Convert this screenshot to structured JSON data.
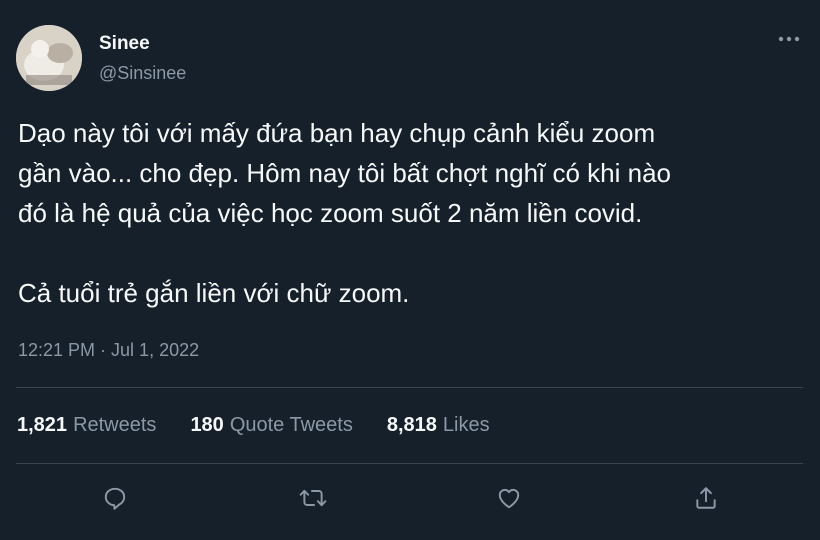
{
  "user": {
    "display_name": "Sinee",
    "handle": "@Sinsinee"
  },
  "tweet": {
    "text": "Dạo này tôi với mấy đứa bạn hay chụp cảnh kiểu zoom\ngần vào... cho đẹp. Hôm nay tôi bất chợt nghĩ có khi nào\nđó là hệ quả của việc học zoom suốt 2 năm liền covid.\n\nCả tuổi trẻ gắn liền với chữ zoom.",
    "timestamp": "12:21 PM · Jul 1, 2022"
  },
  "stats": {
    "retweets_count": "1,821",
    "retweets_label": "Retweets",
    "quotes_count": "180",
    "quotes_label": "Quote Tweets",
    "likes_count": "8,818",
    "likes_label": "Likes"
  },
  "icons": {
    "more": "more-horizontal-icon",
    "reply": "reply-bubble-icon",
    "retweet": "retweet-icon",
    "like": "heart-icon",
    "share": "share-icon"
  },
  "colors": {
    "background": "#15202b",
    "text_primary": "#f7f9f9",
    "text_secondary": "#8b98a5",
    "divider": "#38444d"
  }
}
